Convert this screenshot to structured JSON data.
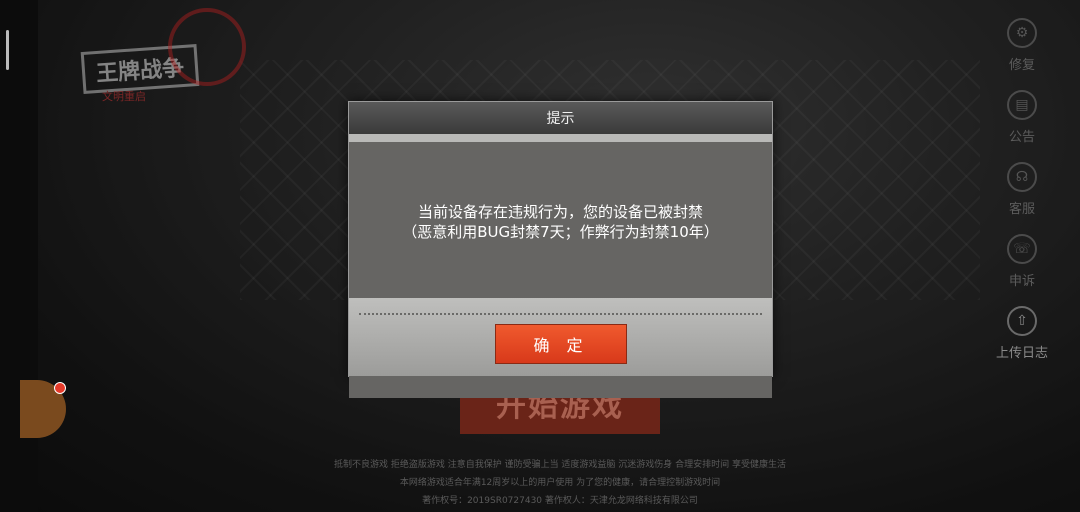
{
  "game": {
    "logo_text": "王牌战争",
    "logo_sub": "文明重启",
    "start_label": "开始游戏"
  },
  "side_menu": [
    {
      "label": "修复",
      "icon": "gear-icon"
    },
    {
      "label": "公告",
      "icon": "notice-icon"
    },
    {
      "label": "客服",
      "icon": "headset-icon"
    },
    {
      "label": "申诉",
      "icon": "appeal-icon"
    },
    {
      "label": "上传日志",
      "icon": "upload-icon"
    }
  ],
  "footer": {
    "line1": "抵制不良游戏 拒绝盗版游戏 注意自我保护 谨防受骗上当 适度游戏益脑 沉迷游戏伤身 合理安排时间 享受健康生活",
    "line2": "本网络游戏适合年满12周岁以上的用户使用 为了您的健康，请合理控制游戏时间",
    "line3": "著作权号：2019SR0727430      著作权人：天津允龙网络科技有限公司"
  },
  "dialog": {
    "title": "提示",
    "message_line1": "当前设备存在违规行为，您的设备已被封禁",
    "message_line2": "（恶意利用BUG封禁7天；作弊行为封禁10年）",
    "confirm_label": "确 定"
  },
  "colors": {
    "confirm_button": "#e8482a",
    "dialog_body": "#666563",
    "accent_red": "#e53a2a"
  }
}
